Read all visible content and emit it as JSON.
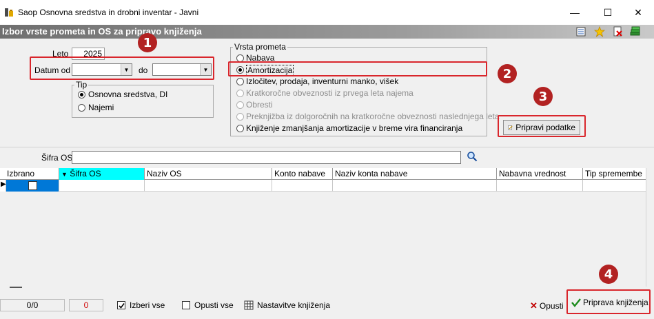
{
  "window": {
    "title": "Saop Osnovna sredstva in drobni inventar - Javni",
    "minimize": "—",
    "maximize": "☐",
    "close": "✕"
  },
  "panel": {
    "title": "Izbor vrste prometa in OS za pripravo knjiženja"
  },
  "filters": {
    "leto_label": "Leto",
    "leto_value": "2025",
    "datum_od_label": "Datum od",
    "datum_od_value": "",
    "do_label": "do",
    "do_value": ""
  },
  "tip": {
    "legend": "Tip",
    "options": [
      {
        "label": "Osnovna sredstva, DI",
        "selected": true
      },
      {
        "label": "Najemi",
        "selected": false
      }
    ]
  },
  "vrsta_prometa": {
    "legend": "Vrsta prometa",
    "options": [
      {
        "label": "Nabava",
        "selected": false,
        "enabled": true
      },
      {
        "label": "Amortizacija",
        "selected": true,
        "enabled": true
      },
      {
        "label": "Izločitev, prodaja, inventurni manko, višek",
        "selected": false,
        "enabled": true
      },
      {
        "label": "Kratkoročne obveznosti iz prvega leta najema",
        "selected": false,
        "enabled": false
      },
      {
        "label": "Obresti",
        "selected": false,
        "enabled": false
      },
      {
        "label": "Preknjižba iz dolgoročnih na kratkoročne obveznosti naslednjega leta",
        "selected": false,
        "enabled": false
      },
      {
        "label": "Knjiženje zmanjšanja amortizacije v breme vira financiranja",
        "selected": false,
        "enabled": true
      }
    ]
  },
  "buttons": {
    "pripravi_podatke": "Pripravi podatke",
    "opusti": "Opusti",
    "priprava_knjizenja": "Priprava knjiženja",
    "izberi_vse": "Izberi vse",
    "opusti_vse": "Opusti vse",
    "nastavitve_knjizenja": "Nastavitve knjiženja"
  },
  "search": {
    "label": "Šifra OS",
    "value": ""
  },
  "grid": {
    "columns": [
      "Izbrano",
      "Šifra OS",
      "Naziv OS",
      "Konto nabave",
      "Naziv konta nabave",
      "Nabavna vrednost",
      "Tip spremembe"
    ]
  },
  "status": {
    "record_count": "0/0",
    "selected_count": "0"
  },
  "badges": [
    "1",
    "2",
    "3",
    "4"
  ],
  "colors": {
    "highlight_box": "#d9262c",
    "badge": "#b22222",
    "sort_column": "#00ffff",
    "selected_cell": "#0078d7"
  }
}
